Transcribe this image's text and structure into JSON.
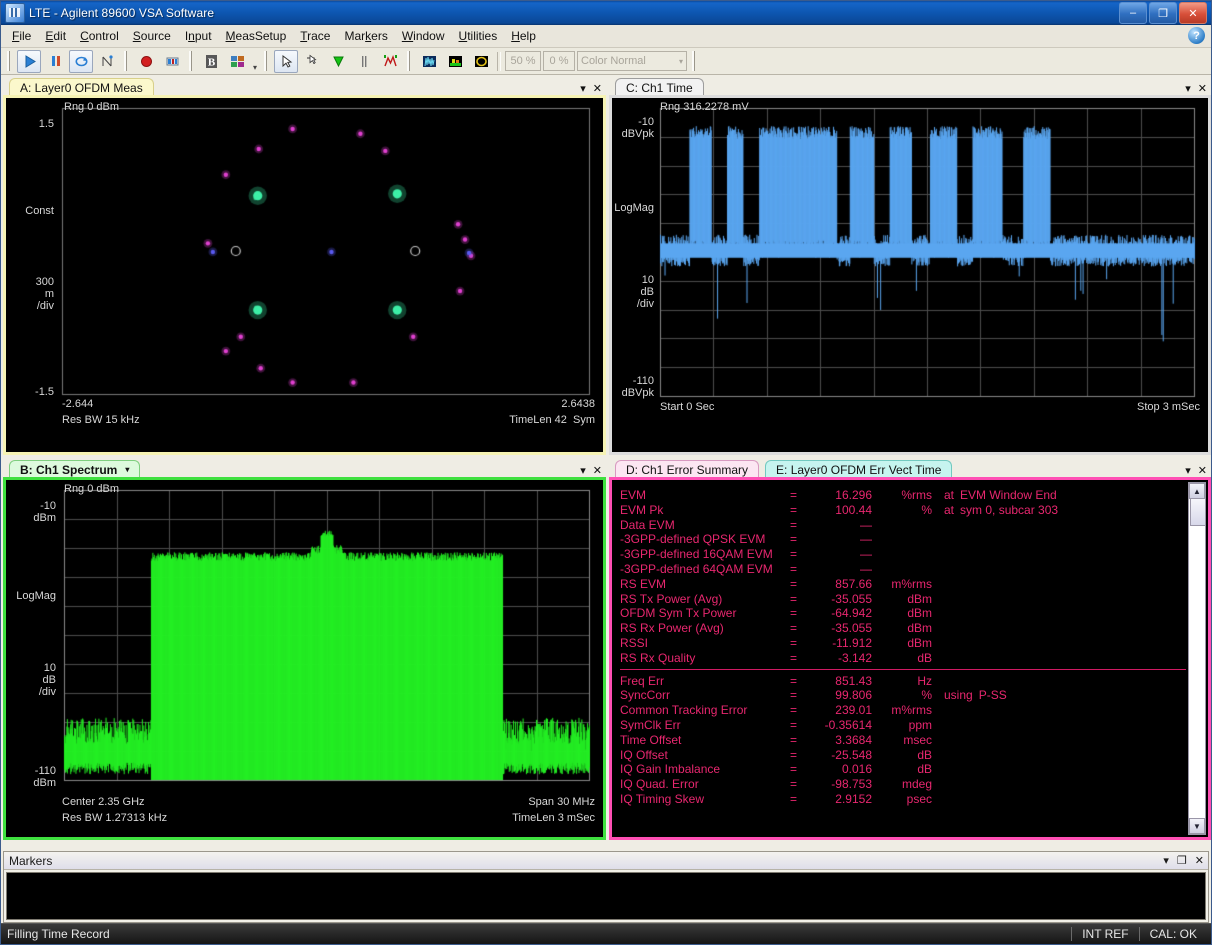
{
  "window": {
    "title": "LTE - Agilent 89600 VSA Software",
    "icon": "vsa-app-icon",
    "minimize": "–",
    "maximize": "❐",
    "close": "✕"
  },
  "menubar": {
    "items": [
      "File",
      "Edit",
      "Control",
      "Source",
      "Input",
      "MeasSetup",
      "Trace",
      "Markers",
      "Window",
      "Utilities",
      "Help"
    ],
    "help_ball": "?"
  },
  "toolbar": {
    "buttons": [
      {
        "name": "play-run-icon",
        "glyph": "▶"
      },
      {
        "name": "pause-icon",
        "glyph": "❙❙"
      },
      {
        "name": "restart-icon",
        "glyph": "↻"
      },
      {
        "name": "single-step-icon",
        "glyph": "⌶"
      },
      {
        "name": "record-icon",
        "glyph": "●"
      },
      {
        "name": "playback-icon",
        "glyph": "▤"
      },
      {
        "name": "bold-b-icon",
        "glyph": "B"
      },
      {
        "name": "grid-layout-icon",
        "glyph": "▦"
      },
      {
        "name": "select-pointer-icon",
        "glyph": "↖"
      },
      {
        "name": "marker-arrow-icon",
        "glyph": "➘"
      },
      {
        "name": "marker-peak-icon",
        "glyph": "▼"
      },
      {
        "name": "marker-bar-icon",
        "glyph": "❘"
      },
      {
        "name": "marker-m-icon",
        "glyph": "M"
      },
      {
        "name": "spectrogram-icon",
        "glyph": "▥"
      },
      {
        "name": "waterfall-icon",
        "glyph": "▩"
      },
      {
        "name": "color-map-icon",
        "glyph": "◉"
      }
    ],
    "persistence_pct": "50 %",
    "floor_pct": "0 %",
    "color_scheme": "Color Normal",
    "color_scheme_caret": "▾"
  },
  "windows": {
    "A": {
      "tab_label": "A: Layer0 OFDM Meas",
      "minimize": "▾",
      "close": "✕",
      "range": "Rng 0 dBm",
      "y_top": "1.5",
      "y_bottom": "-1.5",
      "y_name": "Const",
      "y_div": "300\nm\n/div",
      "x_left": "-2.644",
      "x_right": "2.6438",
      "footer_left": "Res BW 15 kHz",
      "footer_right": "TimeLen 42  Sym"
    },
    "C": {
      "tab_label": "C: Ch1 Time",
      "minimize": "▾",
      "close": "✕",
      "range": "Rng 316.2278 mV",
      "y_top": "-10\ndBVpk",
      "y_bottom": "-110\ndBVpk",
      "y_name": "LogMag",
      "y_div": "10\ndB\n/div",
      "x_left": "Start 0 Sec",
      "x_right": "Stop 3 mSec"
    },
    "B": {
      "tab_label": "B: Ch1 Spectrum",
      "caret": "▾",
      "minimize": "▾",
      "close": "✕",
      "range": "Rng 0 dBm",
      "y_top": "-10\ndBm",
      "y_bottom": "-110\ndBm",
      "y_name": "LogMag",
      "y_div": "10\ndB\n/div",
      "footer_left_1": "Center 2.35 GHz",
      "footer_left_2": "Res BW 1.27313 kHz",
      "footer_right_1": "Span 30 MHz",
      "footer_right_2": "TimeLen 3 mSec"
    },
    "D": {
      "tab_label": "D: Ch1 Error Summary",
      "tab_label_e": "E: Layer0 OFDM Err Vect Time",
      "minimize": "▾",
      "close": "✕",
      "scroll_up": "▲",
      "scroll_down": "▼"
    }
  },
  "error_summary": {
    "group1": [
      {
        "name": "EVM",
        "eq": "=",
        "value": "16.296",
        "unit": "%rms",
        "note_at": "at",
        "note": "EVM Window End"
      },
      {
        "name": "EVM Pk",
        "eq": "=",
        "value": "100.44",
        "unit": "%",
        "note_at": "at",
        "note": "sym 0,  subcar  303"
      },
      {
        "name": "Data EVM",
        "eq": "=",
        "value": "—",
        "unit": "",
        "note_at": "",
        "note": ""
      },
      {
        "name": " -3GPP-defined QPSK EVM",
        "eq": "=",
        "value": "—",
        "unit": "",
        "note_at": "",
        "note": ""
      },
      {
        "name": " -3GPP-defined 16QAM EVM",
        "eq": "=",
        "value": "—",
        "unit": "",
        "note_at": "",
        "note": ""
      },
      {
        "name": " -3GPP-defined 64QAM EVM",
        "eq": "=",
        "value": "—",
        "unit": "",
        "note_at": "",
        "note": ""
      },
      {
        "name": "RS EVM",
        "eq": "=",
        "value": "857.66",
        "unit": "m%rms",
        "note_at": "",
        "note": ""
      },
      {
        "name": "RS Tx Power (Avg)",
        "eq": "=",
        "value": "-35.055",
        "unit": "dBm",
        "note_at": "",
        "note": ""
      },
      {
        "name": "OFDM Sym Tx Power",
        "eq": "=",
        "value": "-64.942",
        "unit": "dBm",
        "note_at": "",
        "note": ""
      },
      {
        "name": "RS Rx Power (Avg)",
        "eq": "=",
        "value": "-35.055",
        "unit": "dBm",
        "note_at": "",
        "note": ""
      },
      {
        "name": "RSSI",
        "eq": "=",
        "value": "-11.912",
        "unit": "dBm",
        "note_at": "",
        "note": ""
      },
      {
        "name": "RS Rx Quality",
        "eq": "=",
        "value": "-3.142",
        "unit": "dB",
        "note_at": "",
        "note": ""
      }
    ],
    "group2": [
      {
        "name": "Freq Err",
        "eq": "=",
        "value": "851.43",
        "unit": "Hz",
        "note_at": "",
        "note": ""
      },
      {
        "name": "SyncCorr",
        "eq": "=",
        "value": "99.806",
        "unit": "%",
        "note_at": "using",
        "note": "P-SS"
      },
      {
        "name": "Common Tracking Error",
        "eq": "=",
        "value": "239.01",
        "unit": "m%rms",
        "note_at": "",
        "note": ""
      },
      {
        "name": "SymClk Err",
        "eq": "=",
        "value": "-0.35614",
        "unit": "ppm",
        "note_at": "",
        "note": ""
      },
      {
        "name": "Time Offset",
        "eq": "=",
        "value": "3.3684",
        "unit": "msec",
        "note_at": "",
        "note": ""
      },
      {
        "name": "IQ Offset",
        "eq": "=",
        "value": "-25.548",
        "unit": "dB",
        "note_at": "",
        "note": ""
      },
      {
        "name": "IQ Gain Imbalance",
        "eq": "=",
        "value": "0.016",
        "unit": "dB",
        "note_at": "",
        "note": ""
      },
      {
        "name": "IQ Quad. Error",
        "eq": "=",
        "value": "-98.753",
        "unit": "mdeg",
        "note_at": "",
        "note": ""
      },
      {
        "name": "IQ Timing Skew",
        "eq": "=",
        "value": "2.9152",
        "unit": "psec",
        "note_at": "",
        "note": ""
      }
    ]
  },
  "markers_dock": {
    "title": "Markers",
    "minimize": "▾",
    "restore": "❐",
    "close": "✕"
  },
  "statusbar": {
    "message": "Filling Time Record",
    "cells": [
      "INT REF",
      "CAL: OK"
    ]
  },
  "colors": {
    "title_blue": "#0d56b0",
    "trace_green": "#24f024",
    "trace_blue": "#5aa6f0",
    "error_text": "#e8276f",
    "const_green": "#3ef0a8",
    "const_magenta": "#e040d0",
    "win_a_border": "#f6f3b4",
    "win_b_border": "#3fe03f",
    "win_d_border": "#ff4fb4"
  },
  "chart_data": [
    {
      "type": "scatter",
      "id": "constellation",
      "title": "A: Layer0 OFDM Meas",
      "xlabel": "",
      "ylabel": "Const",
      "xlim": [
        -2.644,
        2.6438
      ],
      "ylim": [
        -1.5,
        1.5
      ],
      "y_div": 0.3,
      "grid": false,
      "series": [
        {
          "name": "reference-circles",
          "color": "#bdbdbd",
          "marker": "circle-outline",
          "points": [
            [
              -0.9,
              0.0
            ],
            [
              0.9,
              0.0
            ]
          ]
        },
        {
          "name": "rs-pilots",
          "color": "#3ef0a8",
          "points": [
            [
              -0.68,
              0.58
            ],
            [
              0.72,
              0.6
            ],
            [
              -0.68,
              -0.62
            ],
            [
              0.72,
              -0.62
            ]
          ]
        },
        {
          "name": "data-symbols",
          "color": "#e040d0",
          "points": [
            [
              -0.33,
              1.28
            ],
            [
              -0.67,
              1.07
            ],
            [
              -1.0,
              0.8
            ],
            [
              0.35,
              1.23
            ],
            [
              0.6,
              1.05
            ],
            [
              1.33,
              0.28
            ],
            [
              1.4,
              0.12
            ],
            [
              1.46,
              -0.05
            ],
            [
              1.35,
              -0.42
            ],
            [
              0.88,
              -0.9
            ],
            [
              -0.85,
              -0.9
            ],
            [
              -1.0,
              -1.05
            ],
            [
              -0.65,
              -1.23
            ],
            [
              -0.33,
              -1.38
            ],
            [
              0.28,
              -1.38
            ],
            [
              -1.18,
              0.08
            ]
          ]
        },
        {
          "name": "center-symbols",
          "color": "#5a5af0",
          "points": [
            [
              -1.13,
              -0.01
            ],
            [
              0.06,
              -0.01
            ],
            [
              1.44,
              -0.02
            ]
          ]
        }
      ]
    },
    {
      "type": "line",
      "id": "ch1-time",
      "title": "C: Ch1 Time",
      "xlabel": "Time",
      "ylabel": "LogMag",
      "x_start": "Start 0 Sec",
      "x_stop": "Stop 3 mSec",
      "ylim": [
        -110,
        -10
      ],
      "y_unit": "dBVpk",
      "y_div": 10,
      "grid": true,
      "grid_cols": 10,
      "grid_rows": 10,
      "trace_color": "#5aa6f0",
      "description": "Burst LTE downlink envelope: noise floor near -60 dBVpk with 8 high-power bursts reaching about -18 dBVpk",
      "bursts": [
        [
          0.055,
          0.095
        ],
        [
          0.125,
          0.155
        ],
        [
          0.185,
          0.33
        ],
        [
          0.355,
          0.4
        ],
        [
          0.43,
          0.47
        ],
        [
          0.505,
          0.555
        ],
        [
          0.585,
          0.64
        ],
        [
          0.68,
          0.73
        ]
      ]
    },
    {
      "type": "line",
      "id": "ch1-spectrum",
      "title": "B: Ch1 Spectrum",
      "xlabel": "Frequency",
      "ylabel": "LogMag",
      "center": "Center 2.35 GHz",
      "span": "Span 30 MHz",
      "ylim": [
        -110,
        -10
      ],
      "y_unit": "dBm",
      "y_div": 10,
      "grid": true,
      "grid_cols": 10,
      "grid_rows": 10,
      "trace_color": "#24f024",
      "description": "LTE 20 MHz channel occupying center ~66% of span, top near -32 dBm with center carrier spike to -24 dBm; noise floor about -95 dBm outside channel"
    }
  ]
}
